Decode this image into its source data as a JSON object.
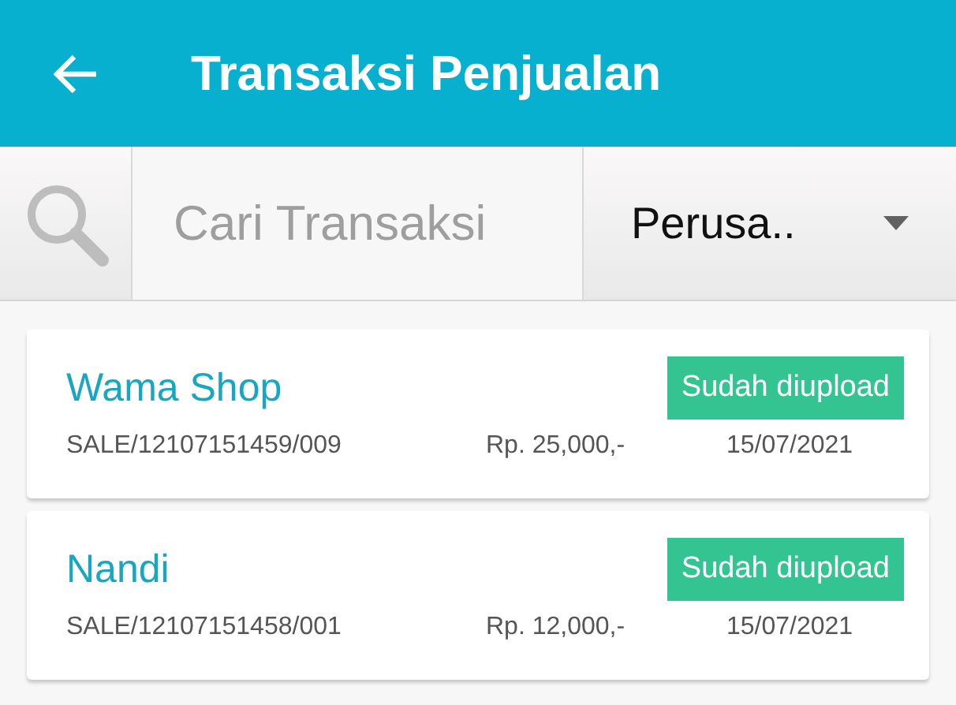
{
  "app_bar": {
    "title": "Transaksi Penjualan"
  },
  "search": {
    "placeholder": "Cari Transaksi"
  },
  "company_dropdown": {
    "value": "Perusa.."
  },
  "transactions": [
    {
      "customer": "Wama Shop",
      "status": "Sudah diupload",
      "number": "SALE/12107151459/009",
      "amount": "Rp. 25,000,-",
      "date": "15/07/2021"
    },
    {
      "customer": "Nandi",
      "status": "Sudah diupload",
      "number": "SALE/12107151458/001",
      "amount": "Rp. 12,000,-",
      "date": "15/07/2021"
    }
  ]
}
